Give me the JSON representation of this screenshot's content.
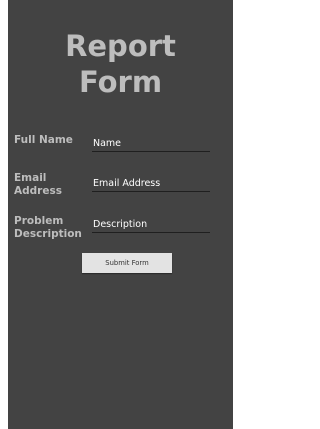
{
  "form": {
    "title_line1": "Report",
    "title_line2": "Form",
    "fields": [
      {
        "label": "Full Name",
        "value": "Name"
      },
      {
        "label_line1": "Email",
        "label_line2": "Address",
        "value": "Email Address"
      },
      {
        "label_line1": "Problem",
        "label_line2": "Description",
        "value": "Description"
      }
    ],
    "submit_label": "Submit Form"
  },
  "colors": {
    "background": "#434343",
    "text_muted": "#bdbdbd",
    "input_text": "#ffffff",
    "button_bg": "#e3e3e3"
  }
}
